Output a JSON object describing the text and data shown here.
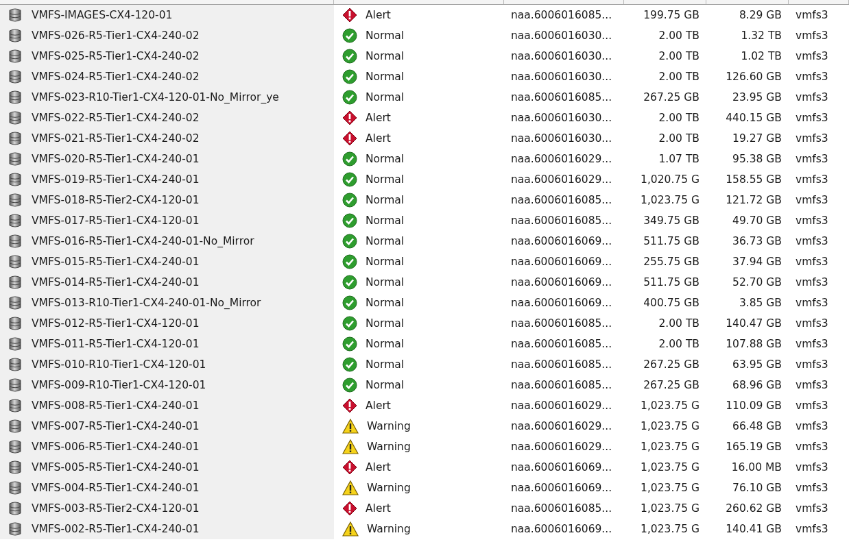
{
  "rows": [
    {
      "name": "VMFS-IMAGES-CX4-120-01",
      "status": {
        "kind": "alert",
        "label": "Alert"
      },
      "device": "naa.6006016085...",
      "capacity": "199.75 GB",
      "free": "8.29 GB",
      "type": "vmfs3"
    },
    {
      "name": "VMFS-026-R5-Tier1-CX4-240-02",
      "status": {
        "kind": "normal",
        "label": "Normal"
      },
      "device": "naa.6006016030...",
      "capacity": "2.00 TB",
      "free": "1.32 TB",
      "type": "vmfs3"
    },
    {
      "name": "VMFS-025-R5-Tier1-CX4-240-02",
      "status": {
        "kind": "normal",
        "label": "Normal"
      },
      "device": "naa.6006016030...",
      "capacity": "2.00 TB",
      "free": "1.02 TB",
      "type": "vmfs3"
    },
    {
      "name": "VMFS-024-R5-Tier1-CX4-240-02",
      "status": {
        "kind": "normal",
        "label": "Normal"
      },
      "device": "naa.6006016030...",
      "capacity": "2.00 TB",
      "free": "126.60 GB",
      "type": "vmfs3"
    },
    {
      "name": "VMFS-023-R10-Tier1-CX4-120-01-No_Mirror_ye",
      "status": {
        "kind": "normal",
        "label": "Normal"
      },
      "device": "naa.6006016085...",
      "capacity": "267.25 GB",
      "free": "23.95 GB",
      "type": "vmfs3"
    },
    {
      "name": "VMFS-022-R5-Tier1-CX4-240-02",
      "status": {
        "kind": "alert",
        "label": "Alert"
      },
      "device": "naa.6006016030...",
      "capacity": "2.00 TB",
      "free": "440.15 GB",
      "type": "vmfs3"
    },
    {
      "name": "VMFS-021-R5-Tier1-CX4-240-02",
      "status": {
        "kind": "alert",
        "label": "Alert"
      },
      "device": "naa.6006016030...",
      "capacity": "2.00 TB",
      "free": "19.27 GB",
      "type": "vmfs3"
    },
    {
      "name": "VMFS-020-R5-Tier1-CX4-240-01",
      "status": {
        "kind": "normal",
        "label": "Normal"
      },
      "device": "naa.6006016029...",
      "capacity": "1.07 TB",
      "free": "95.38 GB",
      "type": "vmfs3"
    },
    {
      "name": "VMFS-019-R5-Tier1-CX4-240-01",
      "status": {
        "kind": "normal",
        "label": "Normal"
      },
      "device": "naa.6006016029...",
      "capacity": "1,020.75 G",
      "free": "158.55 GB",
      "type": "vmfs3"
    },
    {
      "name": "VMFS-018-R5-Tier2-CX4-120-01",
      "status": {
        "kind": "normal",
        "label": "Normal"
      },
      "device": "naa.6006016085...",
      "capacity": "1,023.75 G",
      "free": "121.72 GB",
      "type": "vmfs3"
    },
    {
      "name": "VMFS-017-R5-Tier1-CX4-120-01",
      "status": {
        "kind": "normal",
        "label": "Normal"
      },
      "device": "naa.6006016085...",
      "capacity": "349.75 GB",
      "free": "49.70 GB",
      "type": "vmfs3"
    },
    {
      "name": "VMFS-016-R5-Tier1-CX4-240-01-No_Mirror",
      "status": {
        "kind": "normal",
        "label": "Normal"
      },
      "device": "naa.6006016069...",
      "capacity": "511.75 GB",
      "free": "36.73 GB",
      "type": "vmfs3"
    },
    {
      "name": "VMFS-015-R5-Tier1-CX4-240-01",
      "status": {
        "kind": "normal",
        "label": "Normal"
      },
      "device": "naa.6006016069...",
      "capacity": "255.75 GB",
      "free": "37.94 GB",
      "type": "vmfs3"
    },
    {
      "name": "VMFS-014-R5-Tier1-CX4-240-01",
      "status": {
        "kind": "normal",
        "label": "Normal"
      },
      "device": "naa.6006016069...",
      "capacity": "511.75 GB",
      "free": "52.70 GB",
      "type": "vmfs3"
    },
    {
      "name": "VMFS-013-R10-Tier1-CX4-240-01-No_Mirror",
      "status": {
        "kind": "normal",
        "label": "Normal"
      },
      "device": "naa.6006016069...",
      "capacity": "400.75 GB",
      "free": "3.85 GB",
      "type": "vmfs3"
    },
    {
      "name": "VMFS-012-R5-Tier1-CX4-120-01",
      "status": {
        "kind": "normal",
        "label": "Normal"
      },
      "device": "naa.6006016085...",
      "capacity": "2.00 TB",
      "free": "140.47 GB",
      "type": "vmfs3"
    },
    {
      "name": "VMFS-011-R5-Tier1-CX4-120-01",
      "status": {
        "kind": "normal",
        "label": "Normal"
      },
      "device": "naa.6006016085...",
      "capacity": "2.00 TB",
      "free": "107.88 GB",
      "type": "vmfs3"
    },
    {
      "name": "VMFS-010-R10-Tier1-CX4-120-01",
      "status": {
        "kind": "normal",
        "label": "Normal"
      },
      "device": "naa.6006016085...",
      "capacity": "267.25 GB",
      "free": "63.95 GB",
      "type": "vmfs3"
    },
    {
      "name": "VMFS-009-R10-Tier1-CX4-120-01",
      "status": {
        "kind": "normal",
        "label": "Normal"
      },
      "device": "naa.6006016085...",
      "capacity": "267.25 GB",
      "free": "68.96 GB",
      "type": "vmfs3"
    },
    {
      "name": "VMFS-008-R5-Tier1-CX4-240-01",
      "status": {
        "kind": "alert",
        "label": "Alert"
      },
      "device": "naa.6006016029...",
      "capacity": "1,023.75 G",
      "free": "110.09 GB",
      "type": "vmfs3"
    },
    {
      "name": "VMFS-007-R5-Tier1-CX4-240-01",
      "status": {
        "kind": "warning",
        "label": "Warning"
      },
      "device": "naa.6006016029...",
      "capacity": "1,023.75 G",
      "free": "66.48 GB",
      "type": "vmfs3"
    },
    {
      "name": "VMFS-006-R5-Tier1-CX4-240-01",
      "status": {
        "kind": "warning",
        "label": "Warning"
      },
      "device": "naa.6006016029...",
      "capacity": "1,023.75 G",
      "free": "165.19 GB",
      "type": "vmfs3"
    },
    {
      "name": "VMFS-005-R5-Tier1-CX4-240-01",
      "status": {
        "kind": "alert",
        "label": "Alert"
      },
      "device": "naa.6006016069...",
      "capacity": "1,023.75 G",
      "free": "16.00 MB",
      "type": "vmfs3"
    },
    {
      "name": "VMFS-004-R5-Tier1-CX4-240-01",
      "status": {
        "kind": "warning",
        "label": "Warning"
      },
      "device": "naa.6006016069...",
      "capacity": "1,023.75 G",
      "free": "76.10 GB",
      "type": "vmfs3"
    },
    {
      "name": "VMFS-003-R5-Tier2-CX4-120-01",
      "status": {
        "kind": "alert",
        "label": "Alert"
      },
      "device": "naa.6006016085...",
      "capacity": "1,023.75 G",
      "free": "260.62 GB",
      "type": "vmfs3"
    },
    {
      "name": "VMFS-002-R5-Tier1-CX4-240-01",
      "status": {
        "kind": "warning",
        "label": "Warning"
      },
      "device": "naa.6006016069...",
      "capacity": "1,023.75 G",
      "free": "140.41 GB",
      "type": "vmfs3"
    }
  ]
}
